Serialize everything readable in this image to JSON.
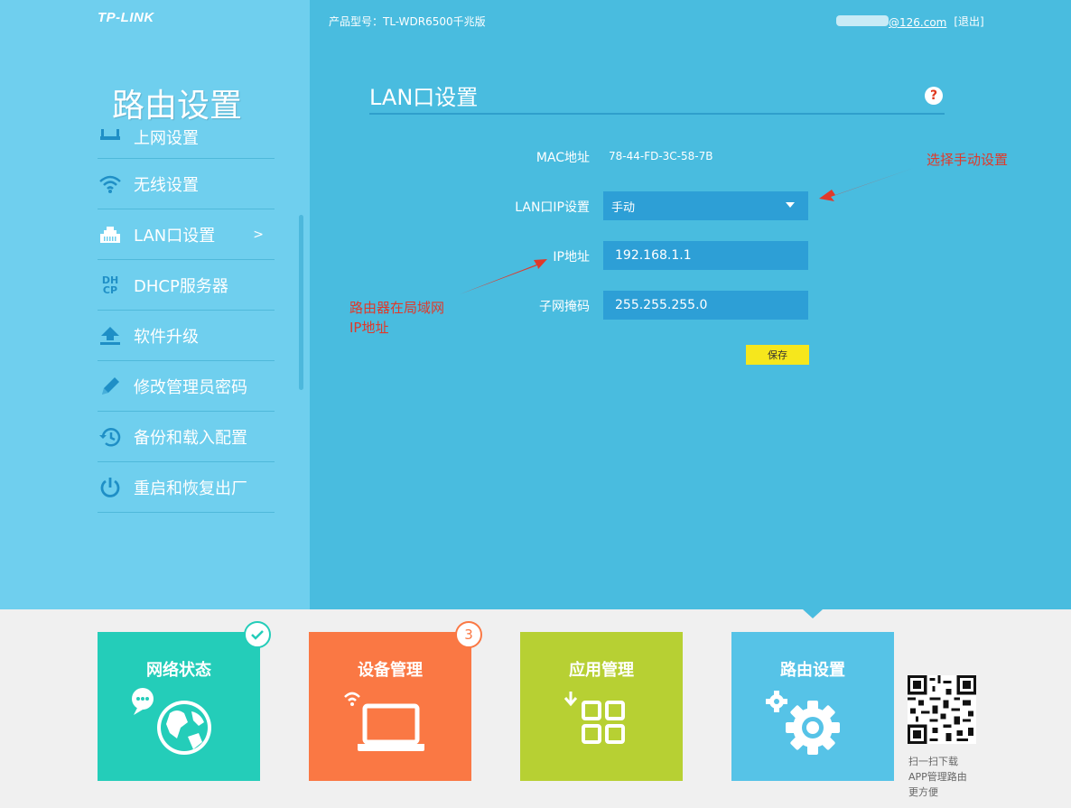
{
  "brand": {
    "logo": "TP-LINK"
  },
  "sidebar": {
    "heading": "路由设置",
    "items": [
      {
        "label": "上网设置",
        "icon": "wan-port-icon"
      },
      {
        "label": "无线设置",
        "icon": "wifi-icon"
      },
      {
        "label": "LAN口设置",
        "icon": "lan-port-icon",
        "active": true,
        "arrow": ">"
      },
      {
        "label": "DHCP服务器",
        "icon": "dhcp-icon",
        "icon_text_top": "DH",
        "icon_text_bottom": "CP"
      },
      {
        "label": "软件升级",
        "icon": "upload-icon"
      },
      {
        "label": "修改管理员密码",
        "icon": "pencil-icon"
      },
      {
        "label": "备份和载入配置",
        "icon": "history-icon"
      },
      {
        "label": "重启和恢复出厂",
        "icon": "power-icon"
      }
    ]
  },
  "header": {
    "model": "产品型号：TL-WDR6500千兆版",
    "email": "@126.com",
    "logout": "[退出]"
  },
  "panel": {
    "title": "LAN口设置",
    "help": "?",
    "mac_label": "MAC地址",
    "mac_value": "78-44-FD-3C-58-7B",
    "lan_ip_label": "LAN口IP设置",
    "lan_ip_mode": "手动",
    "ip_label": "IP地址",
    "ip_value": "192.168.1.1",
    "mask_label": "子网掩码",
    "mask_value": "255.255.255.0",
    "save": "保存"
  },
  "annotations": {
    "select_manual": "选择手动设置",
    "router_ip_line1": "路由器在局域网",
    "router_ip_line2": "IP地址",
    "color": "#e0392a"
  },
  "bottom_nav": {
    "tiles": [
      {
        "label": "网络状态",
        "icon": "globe-icon",
        "color": "#24cdb9"
      },
      {
        "label": "设备管理",
        "icon": "laptop-icon",
        "color": "#fa7844",
        "badge": "3"
      },
      {
        "label": "应用管理",
        "icon": "apps-grid-icon",
        "color": "#b7d033"
      },
      {
        "label": "路由设置",
        "icon": "gears-icon",
        "color": "#56c3e7"
      }
    ],
    "qr_caption_line1": "扫一扫下载",
    "qr_caption_line2": "APP管理路由",
    "qr_caption_line3": "更方便"
  }
}
